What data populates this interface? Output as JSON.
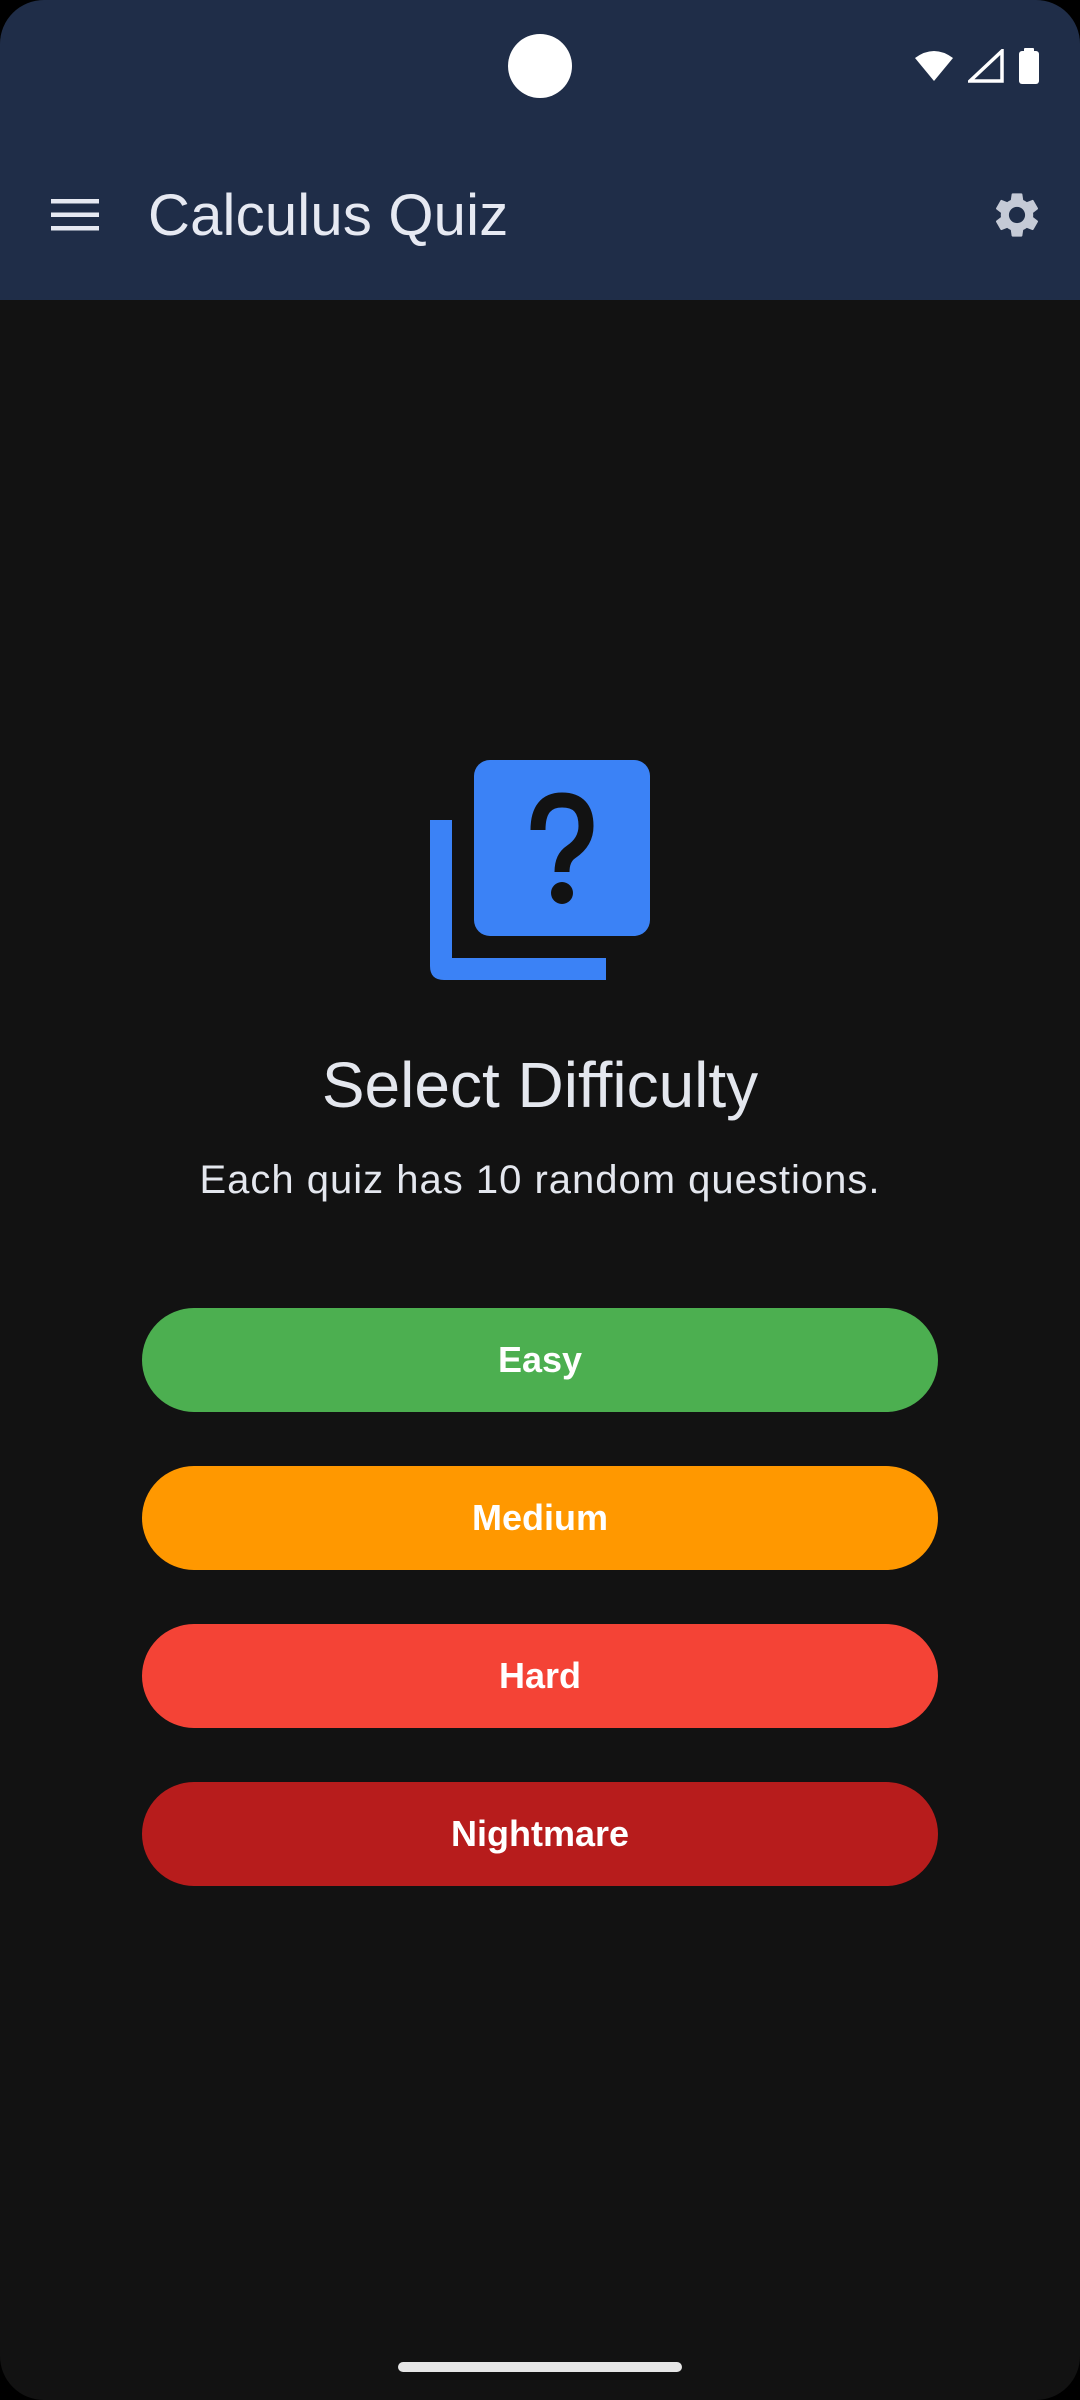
{
  "app_bar": {
    "title": "Calculus Quiz"
  },
  "icons": {
    "menu": "hamburger-menu-icon",
    "settings": "gear-icon",
    "quiz": "quiz-question-stack-icon",
    "status": [
      "wifi-icon",
      "cellular-signal-icon",
      "battery-icon"
    ]
  },
  "main": {
    "heading": "Select Difficulty",
    "subheading": "Each quiz has 10 random questions.",
    "difficulties": [
      {
        "label": "Easy",
        "color": "#4CAF50"
      },
      {
        "label": "Medium",
        "color": "#FF9800"
      },
      {
        "label": "Hard",
        "color": "#F44336"
      },
      {
        "label": "Nightmare",
        "color": "#B71C1C"
      }
    ]
  },
  "colors": {
    "app_bar_bg": "#1F2D48",
    "background": "#121212",
    "accent": "#3B82F6",
    "text_primary": "#E4E7EE"
  }
}
